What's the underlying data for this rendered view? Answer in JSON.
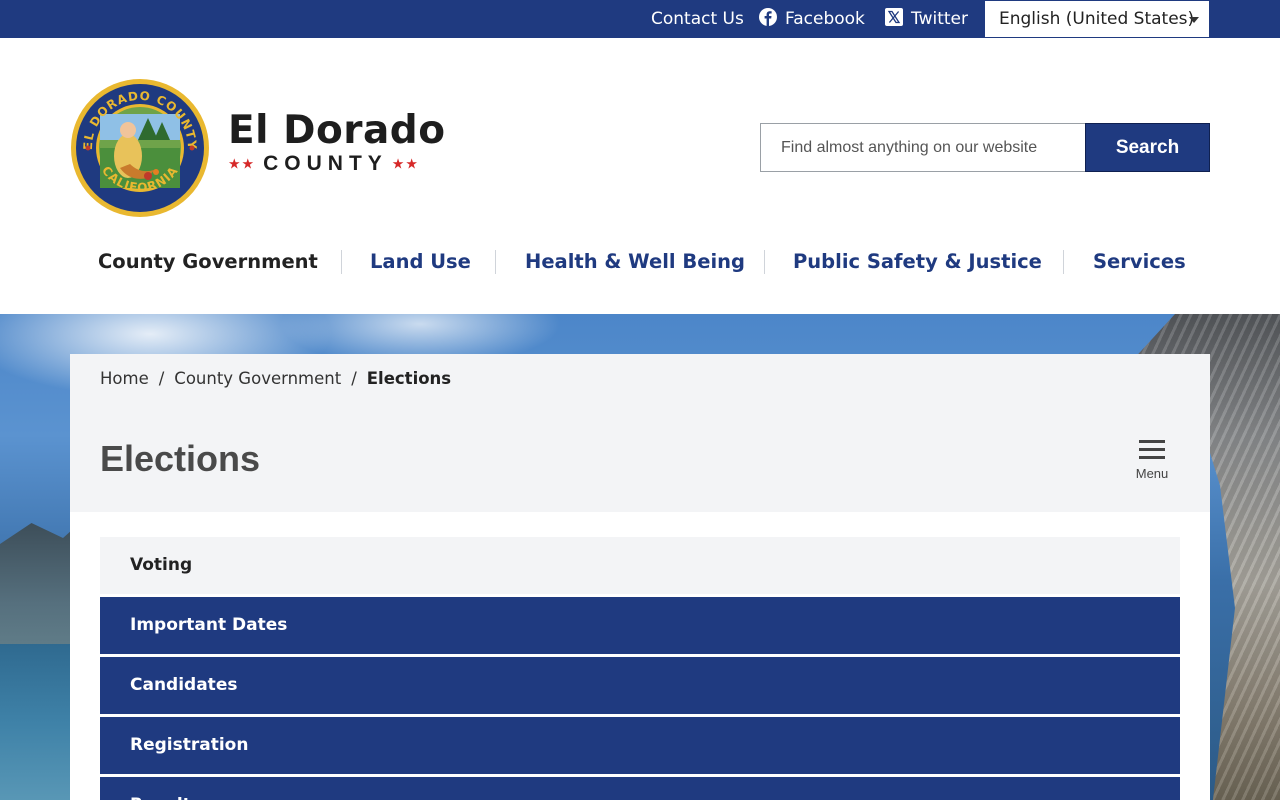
{
  "topbar": {
    "contact": "Contact Us",
    "facebook": "Facebook",
    "twitter": "Twitter",
    "language": "English (United States)"
  },
  "brand": {
    "name": "El Dorado",
    "subtitle": "COUNTY",
    "stars": "★★",
    "seal_text_top": "EL DORADO COUNTY",
    "seal_text_bottom": "CALIFORNIA"
  },
  "search": {
    "placeholder": "Find almost anything on our website",
    "button": "Search"
  },
  "nav": {
    "items": [
      {
        "label": "County Government"
      },
      {
        "label": "Land Use"
      },
      {
        "label": "Health & Well Being"
      },
      {
        "label": "Public Safety & Justice"
      },
      {
        "label": "Services"
      }
    ]
  },
  "breadcrumb": {
    "home": "Home",
    "parent": "County Government",
    "current": "Elections",
    "separator": "/"
  },
  "page": {
    "title": "Elections",
    "menu_label": "Menu"
  },
  "accordion": [
    {
      "label": "Voting"
    },
    {
      "label": "Important Dates"
    },
    {
      "label": "Candidates"
    },
    {
      "label": "Registration"
    },
    {
      "label": "Results"
    }
  ],
  "colors": {
    "brand_blue": "#1f3a80",
    "star_red": "#d62828",
    "panel_gray": "#f3f4f6"
  }
}
